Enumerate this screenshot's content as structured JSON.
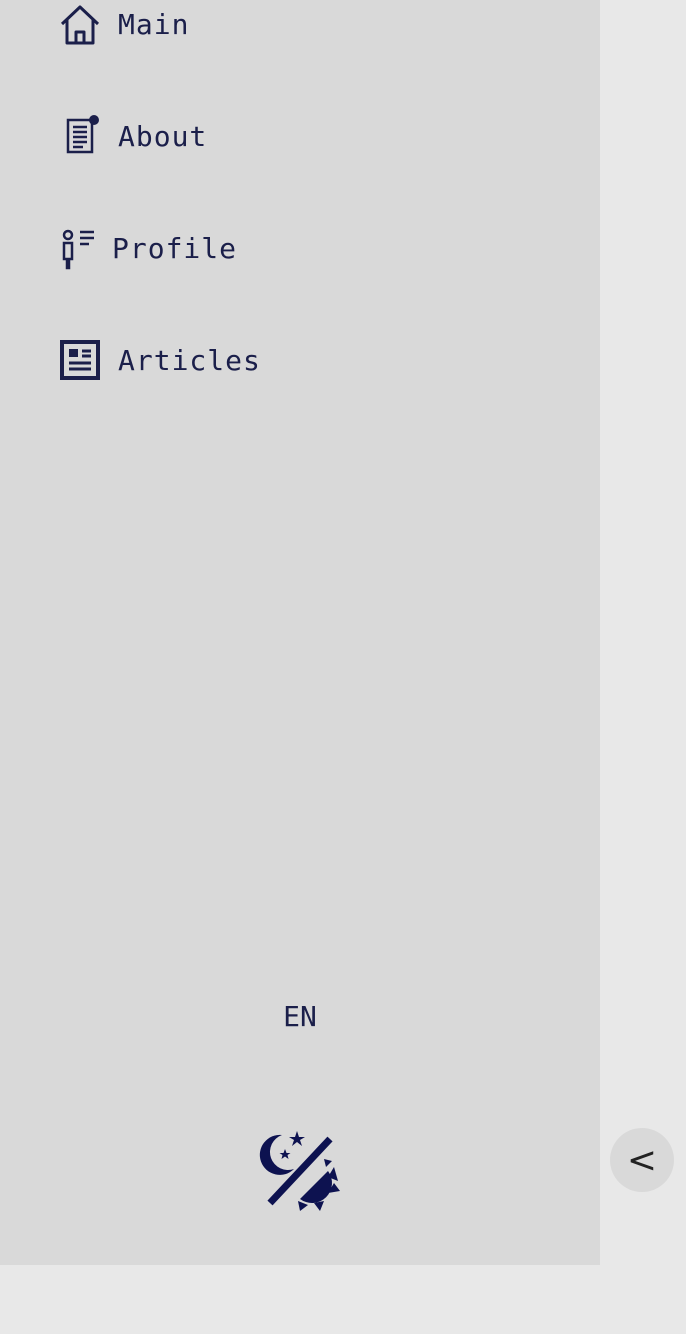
{
  "sidebar": {
    "items": [
      {
        "label": "Main",
        "icon": "home-icon"
      },
      {
        "label": "About",
        "icon": "document-icon"
      },
      {
        "label": "Profile",
        "icon": "profile-icon"
      },
      {
        "label": "Articles",
        "icon": "articles-icon"
      }
    ],
    "language": "EN",
    "theme_icon": "theme-toggle-icon",
    "collapse_label": "<"
  },
  "colors": {
    "sidebar_bg": "#d9d9d9",
    "page_bg": "#e8e8e8",
    "accent": "#1b1f4a"
  }
}
